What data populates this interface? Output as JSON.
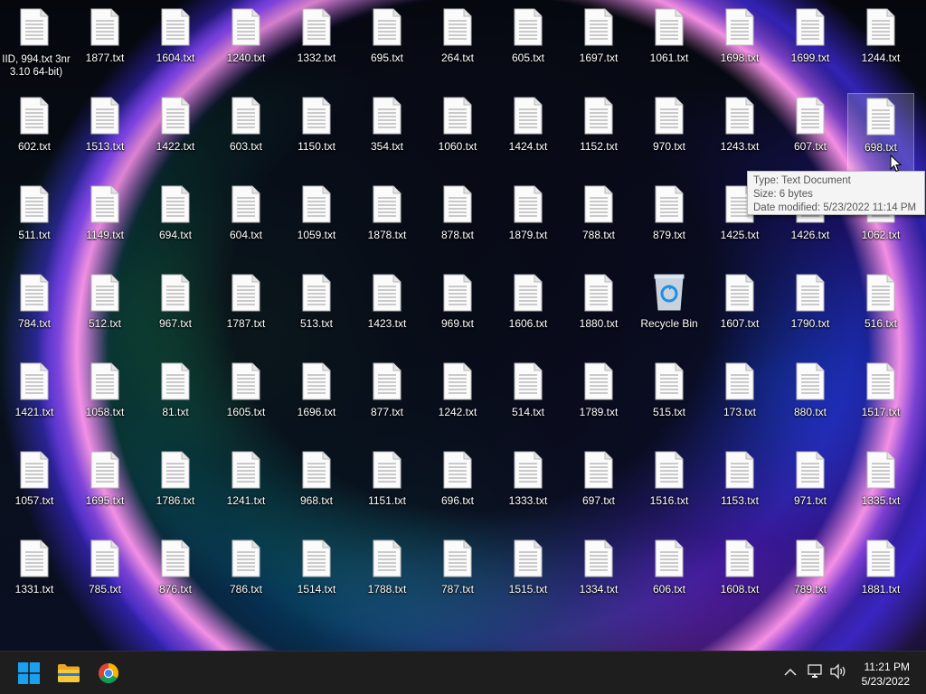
{
  "desktop": {
    "overlap_label": "IID, 994.txt 3nr\n3.10 64-bit)",
    "selected_icon": "698.txt",
    "rows": [
      [
        "",
        "1877.txt",
        "1604.txt",
        "1240.txt",
        "1332.txt",
        "695.txt",
        "264.txt",
        "605.txt",
        "1697.txt",
        "1061.txt",
        "1698.txt",
        "1699.txt",
        "1244.txt"
      ],
      [
        "602.txt",
        "1513.txt",
        "1422.txt",
        "603.txt",
        "1150.txt",
        "354.txt",
        "1060.txt",
        "1424.txt",
        "1152.txt",
        "970.txt",
        "1243.txt",
        "607.txt",
        "698.txt"
      ],
      [
        "511.txt",
        "1149.txt",
        "694.txt",
        "604.txt",
        "1059.txt",
        "1878.txt",
        "878.txt",
        "1879.txt",
        "788.txt",
        "879.txt",
        "1425.txt",
        "1426.txt",
        "1062.txt"
      ],
      [
        "784.txt",
        "512.txt",
        "967.txt",
        "1787.txt",
        "513.txt",
        "1423.txt",
        "969.txt",
        "1606.txt",
        "1880.txt",
        "Recycle Bin",
        "1607.txt",
        "1790.txt",
        "516.txt"
      ],
      [
        "1421.txt",
        "1058.txt",
        "81.txt",
        "1605.txt",
        "1696.txt",
        "877.txt",
        "1242.txt",
        "514.txt",
        "1789.txt",
        "515.txt",
        "173.txt",
        "880.txt",
        "1517.txt"
      ],
      [
        "1057.txt",
        "1695.txt",
        "1786.txt",
        "1241.txt",
        "968.txt",
        "1151.txt",
        "696.txt",
        "1333.txt",
        "697.txt",
        "1516.txt",
        "1153.txt",
        "971.txt",
        "1335.txt"
      ],
      [
        "1331.txt",
        "785.txt",
        "876.txt",
        "786.txt",
        "1514.txt",
        "1788.txt",
        "787.txt",
        "1515.txt",
        "1334.txt",
        "606.txt",
        "1608.txt",
        "789.txt",
        "1881.txt"
      ]
    ]
  },
  "tooltip": {
    "type_line": "Type: Text Document",
    "size_line": "Size: 6 bytes",
    "date_line": "Date modified: 5/23/2022 11:14 PM"
  },
  "taskbar": {
    "pinned": [
      "start-button",
      "file-explorer-button",
      "chrome-button"
    ],
    "clock_time": "11:21 PM",
    "clock_date": "5/23/2022"
  },
  "colors": {
    "taskbar_bg": "#1e1e1e",
    "tooltip_bg": "#f4f4f4",
    "start_blue": "#1aa0f0"
  }
}
